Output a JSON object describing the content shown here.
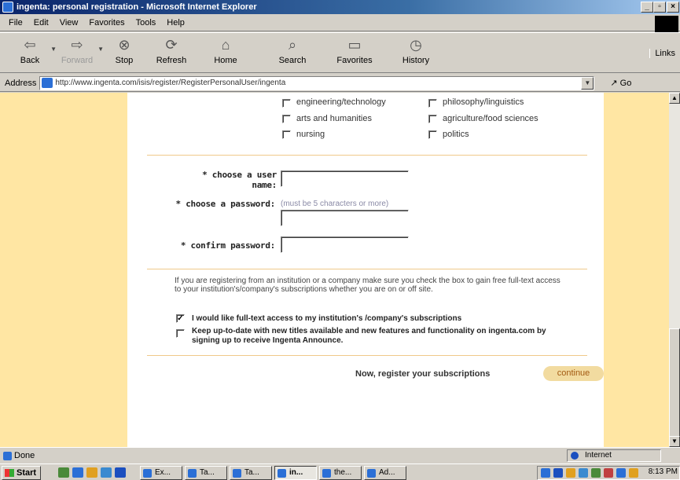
{
  "window": {
    "title": "ingenta: personal registration - Microsoft Internet Explorer"
  },
  "menu": [
    "File",
    "Edit",
    "View",
    "Favorites",
    "Tools",
    "Help"
  ],
  "toolbar": {
    "back": "Back",
    "forward": "Forward",
    "stop": "Stop",
    "refresh": "Refresh",
    "home": "Home",
    "search": "Search",
    "favorites": "Favorites",
    "history": "History",
    "links": "Links"
  },
  "address": {
    "label": "Address",
    "url": "http://www.ingenta.com/isis/register/RegisterPersonalUser/ingenta",
    "go": "Go"
  },
  "subjects": [
    {
      "label": "engineering/technology",
      "checked": false
    },
    {
      "label": "philosophy/linguistics",
      "checked": false
    },
    {
      "label": "arts and humanities",
      "checked": false
    },
    {
      "label": "agriculture/food sciences",
      "checked": false
    },
    {
      "label": "nursing",
      "checked": false
    },
    {
      "label": "politics",
      "checked": false
    }
  ],
  "form": {
    "username_label": "* choose a user name:",
    "password_label": "* choose a password:",
    "password_hint": "(must be 5 characters or more)",
    "confirm_label": "* confirm password:"
  },
  "institution": {
    "paragraph": "If you are registering from an institution or a company make sure you check the box to gain free full-text access to your institution's/company's subscriptions whether you are on or off site.",
    "option1": "I would like full-text access to my institution's /company's subscriptions",
    "option1_checked": true,
    "option2": "Keep up-to-date with new titles available and new features and functionality on ingenta.com by signing up to receive Ingenta Announce.",
    "option2_checked": false
  },
  "register": {
    "text": "Now, register your subscriptions",
    "continue": "continue"
  },
  "status": {
    "text": "Done",
    "zone": "Internet"
  },
  "taskbar": {
    "start": "Start",
    "tasks": [
      "Ex...",
      "Ta...",
      "Ta...",
      "in...",
      "the...",
      "Ad..."
    ],
    "clock": "8:13 PM"
  },
  "colors": {
    "page_bg": "#ffe6a3",
    "accent": "#f0c98a",
    "continue_bg": "#f2dba0",
    "continue_text": "#a35a12"
  }
}
